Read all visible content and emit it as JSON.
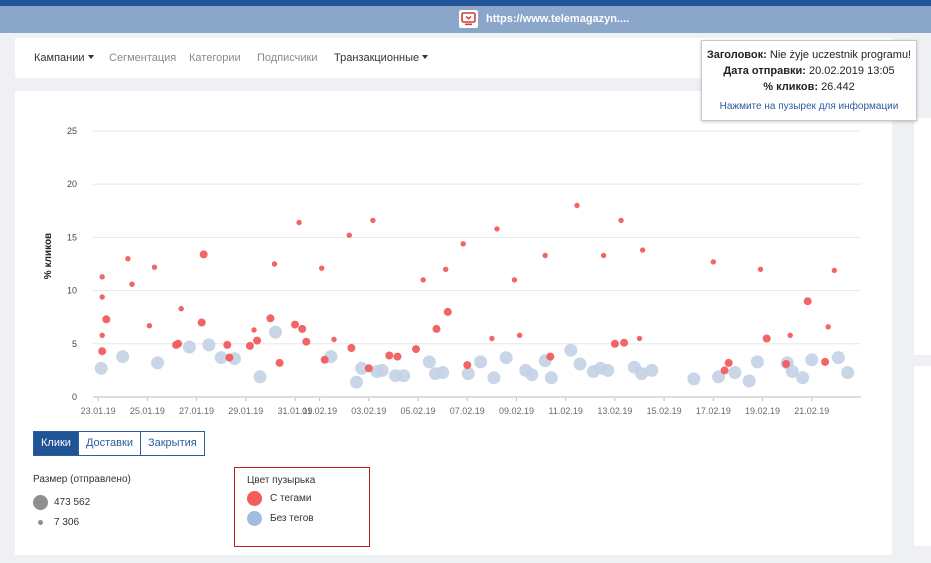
{
  "browser": {
    "url": "https://www.telemagazyn...."
  },
  "nav": {
    "items": [
      {
        "label": "Кампании",
        "has_caret": true
      },
      {
        "label": "Сегментация",
        "has_caret": false
      },
      {
        "label": "Категории",
        "has_caret": false
      },
      {
        "label": "Подписчики",
        "has_caret": false
      },
      {
        "label": "Транзакционные",
        "has_caret": true
      }
    ]
  },
  "tooltip": {
    "title_label": "Заголовок:",
    "title_value": "Nie żyje uczestnik programu!",
    "date_label": "Дата отправки:",
    "date_value": "20.02.2019 13:05",
    "clicks_label": "% кликов:",
    "clicks_value": "26.442",
    "hint": "Нажмите на пузырек для информации"
  },
  "tabs": [
    {
      "label": "Клики",
      "active": true
    },
    {
      "label": "Доставки",
      "active": false
    },
    {
      "label": "Закрытия",
      "active": false
    }
  ],
  "legend_size": {
    "title": "Размер (отправлено)",
    "max_label": "473 562",
    "min_label": "7 306"
  },
  "legend_color": {
    "title": "Цвет пузырька",
    "tagged_label": "С тегами",
    "untagged_label": "Без тегов"
  },
  "colors": {
    "tagged": "#f25c5c",
    "untagged": "#c3d2e5",
    "accent": "#1f5496",
    "highlight_border": "#b81f1f"
  },
  "icons": {
    "site_favicon": "tv-icon"
  },
  "chart_data": {
    "type": "scatter",
    "title": "",
    "xlabel": "",
    "ylabel": "% кликов",
    "ylim": [
      0,
      26.5
    ],
    "yticks": [
      0,
      5,
      10,
      15,
      20,
      25
    ],
    "xlim": [
      "2019-01-22T19:00",
      "2019-02-23T00:00"
    ],
    "x_ticks": [
      {
        "date": "2019-01-23",
        "label": "23.01.19"
      },
      {
        "date": "2019-01-25",
        "label": "25.01.19"
      },
      {
        "date": "2019-01-27",
        "label": "27.01.19"
      },
      {
        "date": "2019-01-29",
        "label": "29.01.19"
      },
      {
        "date": "2019-01-31",
        "label": "31.01.19"
      },
      {
        "date": "2019-02-01",
        "label": "01.02.19"
      },
      {
        "date": "2019-02-03",
        "label": "03.02.19"
      },
      {
        "date": "2019-02-05",
        "label": "05.02.19"
      },
      {
        "date": "2019-02-07",
        "label": "07.02.19"
      },
      {
        "date": "2019-02-09",
        "label": "09.02.19"
      },
      {
        "date": "2019-02-11",
        "label": "11.02.19"
      },
      {
        "date": "2019-02-13",
        "label": "13.02.19"
      },
      {
        "date": "2019-02-15",
        "label": "15.02.19"
      },
      {
        "date": "2019-02-17",
        "label": "17.02.19"
      },
      {
        "date": "2019-02-19",
        "label": "19.02.19"
      },
      {
        "date": "2019-02-21",
        "label": "21.02.19"
      }
    ],
    "series": [
      {
        "name": "С тегами",
        "color": "#f25c5c",
        "points": [
          {
            "x": "2019-01-23T04:00",
            "y": 11.3,
            "size": "s"
          },
          {
            "x": "2019-01-23T04:00",
            "y": 9.4,
            "size": "s"
          },
          {
            "x": "2019-01-23T04:00",
            "y": 5.8,
            "size": "s"
          },
          {
            "x": "2019-01-23T04:00",
            "y": 4.3,
            "size": "m"
          },
          {
            "x": "2019-01-23T08:00",
            "y": 7.3,
            "size": "m"
          },
          {
            "x": "2019-01-24T05:00",
            "y": 13.0,
            "size": "s"
          },
          {
            "x": "2019-01-24T09:00",
            "y": 10.6,
            "size": "s"
          },
          {
            "x": "2019-01-25T02:00",
            "y": 6.7,
            "size": "s"
          },
          {
            "x": "2019-01-25T07:00",
            "y": 12.2,
            "size": "s"
          },
          {
            "x": "2019-01-26T04:00",
            "y": 4.9,
            "size": "m"
          },
          {
            "x": "2019-01-26T06:00",
            "y": 5.0,
            "size": "m"
          },
          {
            "x": "2019-01-26T09:00",
            "y": 8.3,
            "size": "s"
          },
          {
            "x": "2019-01-27T05:00",
            "y": 7.0,
            "size": "m"
          },
          {
            "x": "2019-01-27T07:00",
            "y": 13.4,
            "size": "m"
          },
          {
            "x": "2019-01-28T06:00",
            "y": 4.9,
            "size": "m"
          },
          {
            "x": "2019-01-28T08:00",
            "y": 3.7,
            "size": "m"
          },
          {
            "x": "2019-01-29T04:00",
            "y": 4.8,
            "size": "m"
          },
          {
            "x": "2019-01-29T08:00",
            "y": 6.3,
            "size": "s"
          },
          {
            "x": "2019-01-29T11:00",
            "y": 5.3,
            "size": "m"
          },
          {
            "x": "2019-01-30T00:00",
            "y": 7.4,
            "size": "m"
          },
          {
            "x": "2019-01-30T04:00",
            "y": 12.5,
            "size": "s"
          },
          {
            "x": "2019-01-30T09:00",
            "y": 3.2,
            "size": "m"
          },
          {
            "x": "2019-01-31T00:00",
            "y": 6.8,
            "size": "m"
          },
          {
            "x": "2019-01-31T04:00",
            "y": 16.4,
            "size": "s"
          },
          {
            "x": "2019-01-31T07:00",
            "y": 6.4,
            "size": "m"
          },
          {
            "x": "2019-01-31T11:00",
            "y": 5.2,
            "size": "m"
          },
          {
            "x": "2019-02-01T02:00",
            "y": 12.1,
            "size": "s"
          },
          {
            "x": "2019-02-01T05:00",
            "y": 3.5,
            "size": "m"
          },
          {
            "x": "2019-02-01T14:00",
            "y": 5.4,
            "size": "s"
          },
          {
            "x": "2019-02-02T05:00",
            "y": 15.2,
            "size": "s"
          },
          {
            "x": "2019-02-02T07:00",
            "y": 4.6,
            "size": "m"
          },
          {
            "x": "2019-02-03T00:00",
            "y": 2.7,
            "size": "m"
          },
          {
            "x": "2019-02-03T04:00",
            "y": 16.6,
            "size": "s"
          },
          {
            "x": "2019-02-03T20:00",
            "y": 3.9,
            "size": "m"
          },
          {
            "x": "2019-02-04T04:00",
            "y": 3.8,
            "size": "m"
          },
          {
            "x": "2019-02-04T22:00",
            "y": 4.5,
            "size": "m"
          },
          {
            "x": "2019-02-05T05:00",
            "y": 11.0,
            "size": "s"
          },
          {
            "x": "2019-02-05T18:00",
            "y": 6.4,
            "size": "m"
          },
          {
            "x": "2019-02-06T03:00",
            "y": 12.0,
            "size": "s"
          },
          {
            "x": "2019-02-06T05:00",
            "y": 8.0,
            "size": "m"
          },
          {
            "x": "2019-02-06T20:00",
            "y": 14.4,
            "size": "s"
          },
          {
            "x": "2019-02-07T00:00",
            "y": 3.0,
            "size": "m"
          },
          {
            "x": "2019-02-08T00:00",
            "y": 5.5,
            "size": "s"
          },
          {
            "x": "2019-02-08T05:00",
            "y": 15.8,
            "size": "s"
          },
          {
            "x": "2019-02-08T22:00",
            "y": 11.0,
            "size": "s"
          },
          {
            "x": "2019-02-09T03:00",
            "y": 5.8,
            "size": "s"
          },
          {
            "x": "2019-02-10T04:00",
            "y": 13.3,
            "size": "s"
          },
          {
            "x": "2019-02-10T09:00",
            "y": 3.8,
            "size": "m"
          },
          {
            "x": "2019-02-11T11:00",
            "y": 18.0,
            "size": "s"
          },
          {
            "x": "2019-02-12T13:00",
            "y": 13.3,
            "size": "s"
          },
          {
            "x": "2019-02-13T00:00",
            "y": 5.0,
            "size": "m"
          },
          {
            "x": "2019-02-13T06:00",
            "y": 16.6,
            "size": "s"
          },
          {
            "x": "2019-02-13T09:00",
            "y": 5.1,
            "size": "m"
          },
          {
            "x": "2019-02-14T00:00",
            "y": 5.5,
            "size": "s"
          },
          {
            "x": "2019-02-14T03:00",
            "y": 13.8,
            "size": "s"
          },
          {
            "x": "2019-02-17T00:00",
            "y": 12.7,
            "size": "s"
          },
          {
            "x": "2019-02-17T11:00",
            "y": 2.5,
            "size": "m"
          },
          {
            "x": "2019-02-17T15:00",
            "y": 3.2,
            "size": "m"
          },
          {
            "x": "2019-02-18T22:00",
            "y": 12.0,
            "size": "s"
          },
          {
            "x": "2019-02-19T04:00",
            "y": 5.5,
            "size": "m"
          },
          {
            "x": "2019-02-19T23:00",
            "y": 3.1,
            "size": "m"
          },
          {
            "x": "2019-02-20T03:00",
            "y": 5.8,
            "size": "s"
          },
          {
            "x": "2019-02-20T13:05",
            "y": 26.442,
            "size": "m"
          },
          {
            "x": "2019-02-20T20:00",
            "y": 9.0,
            "size": "m"
          },
          {
            "x": "2019-02-21T13:00",
            "y": 3.3,
            "size": "m"
          },
          {
            "x": "2019-02-21T16:00",
            "y": 6.6,
            "size": "s"
          },
          {
            "x": "2019-02-21T22:00",
            "y": 11.9,
            "size": "s"
          }
        ]
      },
      {
        "name": "Без тегов",
        "color": "#c3d2e5",
        "points": [
          {
            "x": "2019-01-23T03:00",
            "y": 2.7,
            "size": "l"
          },
          {
            "x": "2019-01-24T00:00",
            "y": 3.8,
            "size": "l"
          },
          {
            "x": "2019-01-25T10:00",
            "y": 3.2,
            "size": "l"
          },
          {
            "x": "2019-01-26T17:00",
            "y": 4.7,
            "size": "l"
          },
          {
            "x": "2019-01-27T12:00",
            "y": 4.9,
            "size": "l"
          },
          {
            "x": "2019-01-28T00:00",
            "y": 3.7,
            "size": "l"
          },
          {
            "x": "2019-01-28T13:00",
            "y": 3.6,
            "size": "l"
          },
          {
            "x": "2019-01-29T14:00",
            "y": 1.9,
            "size": "l"
          },
          {
            "x": "2019-01-30T05:00",
            "y": 6.1,
            "size": "l"
          },
          {
            "x": "2019-02-01T11:00",
            "y": 3.8,
            "size": "l"
          },
          {
            "x": "2019-02-02T12:00",
            "y": 1.4,
            "size": "l"
          },
          {
            "x": "2019-02-02T17:00",
            "y": 2.7,
            "size": "l"
          },
          {
            "x": "2019-02-03T08:00",
            "y": 2.4,
            "size": "l"
          },
          {
            "x": "2019-02-03T13:00",
            "y": 2.5,
            "size": "l"
          },
          {
            "x": "2019-02-04T02:00",
            "y": 2.0,
            "size": "l"
          },
          {
            "x": "2019-02-04T10:00",
            "y": 2.0,
            "size": "l"
          },
          {
            "x": "2019-02-05T11:00",
            "y": 3.3,
            "size": "l"
          },
          {
            "x": "2019-02-05T17:00",
            "y": 2.2,
            "size": "l"
          },
          {
            "x": "2019-02-06T00:00",
            "y": 2.3,
            "size": "l"
          },
          {
            "x": "2019-02-07T01:00",
            "y": 2.2,
            "size": "l"
          },
          {
            "x": "2019-02-07T13:00",
            "y": 3.3,
            "size": "l"
          },
          {
            "x": "2019-02-08T02:00",
            "y": 1.8,
            "size": "l"
          },
          {
            "x": "2019-02-08T14:00",
            "y": 3.7,
            "size": "l"
          },
          {
            "x": "2019-02-09T09:00",
            "y": 2.5,
            "size": "l"
          },
          {
            "x": "2019-02-09T15:00",
            "y": 2.1,
            "size": "l"
          },
          {
            "x": "2019-02-10T04:00",
            "y": 3.4,
            "size": "l"
          },
          {
            "x": "2019-02-10T10:00",
            "y": 1.8,
            "size": "l"
          },
          {
            "x": "2019-02-11T05:00",
            "y": 4.4,
            "size": "l"
          },
          {
            "x": "2019-02-11T14:00",
            "y": 3.1,
            "size": "l"
          },
          {
            "x": "2019-02-12T03:00",
            "y": 2.4,
            "size": "l"
          },
          {
            "x": "2019-02-12T10:00",
            "y": 2.7,
            "size": "l"
          },
          {
            "x": "2019-02-12T17:00",
            "y": 2.5,
            "size": "l"
          },
          {
            "x": "2019-02-13T19:00",
            "y": 2.8,
            "size": "l"
          },
          {
            "x": "2019-02-14T02:00",
            "y": 2.2,
            "size": "l"
          },
          {
            "x": "2019-02-14T12:00",
            "y": 2.5,
            "size": "l"
          },
          {
            "x": "2019-02-16T05:00",
            "y": 1.7,
            "size": "l"
          },
          {
            "x": "2019-02-17T05:00",
            "y": 1.9,
            "size": "l"
          },
          {
            "x": "2019-02-17T21:00",
            "y": 2.3,
            "size": "l"
          },
          {
            "x": "2019-02-18T11:00",
            "y": 1.5,
            "size": "l"
          },
          {
            "x": "2019-02-18T19:00",
            "y": 3.3,
            "size": "l"
          },
          {
            "x": "2019-02-20T00:00",
            "y": 3.2,
            "size": "l"
          },
          {
            "x": "2019-02-20T05:00",
            "y": 2.4,
            "size": "l"
          },
          {
            "x": "2019-02-20T15:00",
            "y": 1.8,
            "size": "l"
          },
          {
            "x": "2019-02-21T00:00",
            "y": 3.5,
            "size": "l"
          },
          {
            "x": "2019-02-22T02:00",
            "y": 3.7,
            "size": "l"
          },
          {
            "x": "2019-02-22T11:00",
            "y": 2.3,
            "size": "l"
          }
        ]
      }
    ]
  }
}
